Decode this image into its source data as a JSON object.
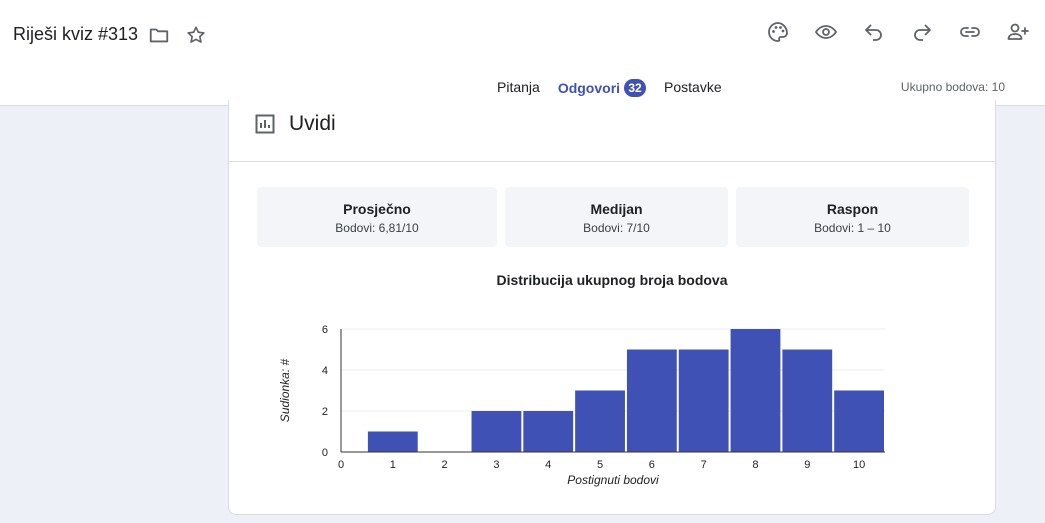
{
  "header": {
    "title": "Riješi kviz #313",
    "total_points": "Ukupno bodova: 10"
  },
  "tabs": [
    {
      "label": "Pitanja"
    },
    {
      "label": "Odgovori",
      "badge": "32"
    },
    {
      "label": "Postavke"
    }
  ],
  "insights": {
    "title": "Uvidi"
  },
  "stats": [
    {
      "label": "Prosječno",
      "value": "Bodovi: 6,81/10"
    },
    {
      "label": "Medijan",
      "value": "Bodovi: 7/10"
    },
    {
      "label": "Raspon",
      "value": "Bodovi: 1 – 10"
    }
  ],
  "colors": {
    "accent": "#3f51b5",
    "bar": "#3f51b5"
  },
  "chart_data": {
    "type": "bar",
    "title": "Distribucija ukupnog broja bodova",
    "xlabel": "Postignuti bodovi",
    "ylabel": "Sudionka: #",
    "x": [
      1,
      2,
      3,
      4,
      5,
      6,
      7,
      8,
      9,
      10
    ],
    "values": [
      1,
      0,
      2,
      2,
      3,
      5,
      5,
      6,
      5,
      3
    ],
    "x_ticks": [
      0,
      1,
      2,
      3,
      4,
      5,
      6,
      7,
      8,
      9,
      10
    ],
    "y_ticks": [
      0,
      2,
      4,
      6
    ],
    "xlim": [
      0,
      10.5
    ],
    "ylim": [
      0,
      6
    ],
    "grid": true
  }
}
